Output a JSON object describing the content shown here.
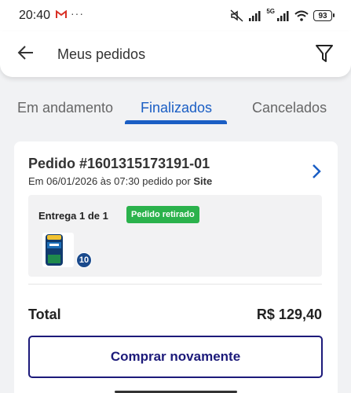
{
  "statusbar": {
    "time": "20:40",
    "dots": "···",
    "network": "5G",
    "battery": "93"
  },
  "header": {
    "title": "Meus pedidos",
    "back_icon": "arrow-left-icon",
    "filter_icon": "filter-icon"
  },
  "tabs": [
    {
      "label": "Em andamento",
      "active": false
    },
    {
      "label": "Finalizados",
      "active": true
    },
    {
      "label": "Cancelados",
      "active": false
    }
  ],
  "colors": {
    "accent": "#1a5ec4",
    "status_green": "#2bb24c",
    "button_border": "#1c1a7a"
  },
  "order": {
    "number": "Pedido #1601315173191-01",
    "date_prefix": "Em 06/01/2026 às 07:30 pedido por ",
    "channel": "Site",
    "delivery_label": "Entrega 1 de 1",
    "delivery_status": "Pedido retirado",
    "product_quantity": "10",
    "total_label": "Total",
    "total_value": "R$ 129,40",
    "rebuy_label": "Comprar novamente"
  }
}
